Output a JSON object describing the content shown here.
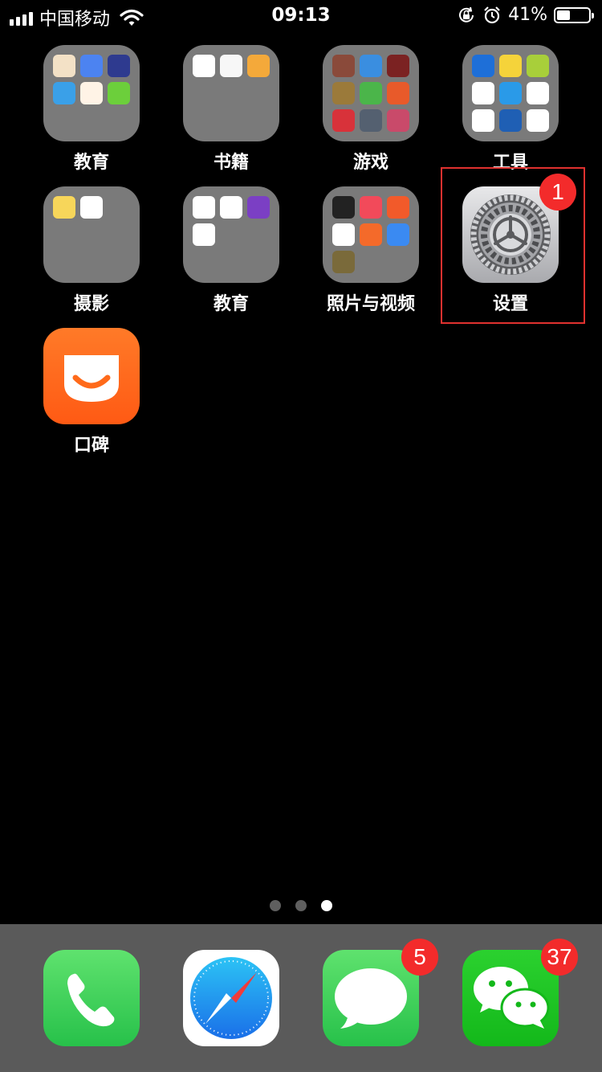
{
  "status_bar": {
    "carrier": "中国移动",
    "time": "09:13",
    "battery_percent": "41%",
    "battery_level": 0.41,
    "icons": [
      "signal-icon",
      "wifi-icon",
      "rotation-lock-icon",
      "alarm-icon",
      "battery-icon"
    ]
  },
  "apps": [
    {
      "label": "教育",
      "type": "folder"
    },
    {
      "label": "书籍",
      "type": "folder"
    },
    {
      "label": "游戏",
      "type": "folder"
    },
    {
      "label": "工具",
      "type": "folder"
    },
    {
      "label": "摄影",
      "type": "folder"
    },
    {
      "label": "教育",
      "type": "folder"
    },
    {
      "label": "照片与视频",
      "type": "folder"
    },
    {
      "label": "设置",
      "type": "app",
      "badge": "1"
    },
    {
      "label": "口碑",
      "type": "app"
    }
  ],
  "page_indicator": {
    "count": 3,
    "active": 3
  },
  "dock": [
    {
      "name": "phone-app",
      "badge": ""
    },
    {
      "name": "safari-app",
      "badge": ""
    },
    {
      "name": "messages-app",
      "badge": "5"
    },
    {
      "name": "wechat-app",
      "badge": "37"
    }
  ],
  "colors": {
    "badge": "#f32b2b",
    "folder": "#7a7a7a",
    "highlight": "#e0312f",
    "koubei": "#ff6a1a",
    "phone": "#3fd45b",
    "wechat": "#18c21a"
  }
}
